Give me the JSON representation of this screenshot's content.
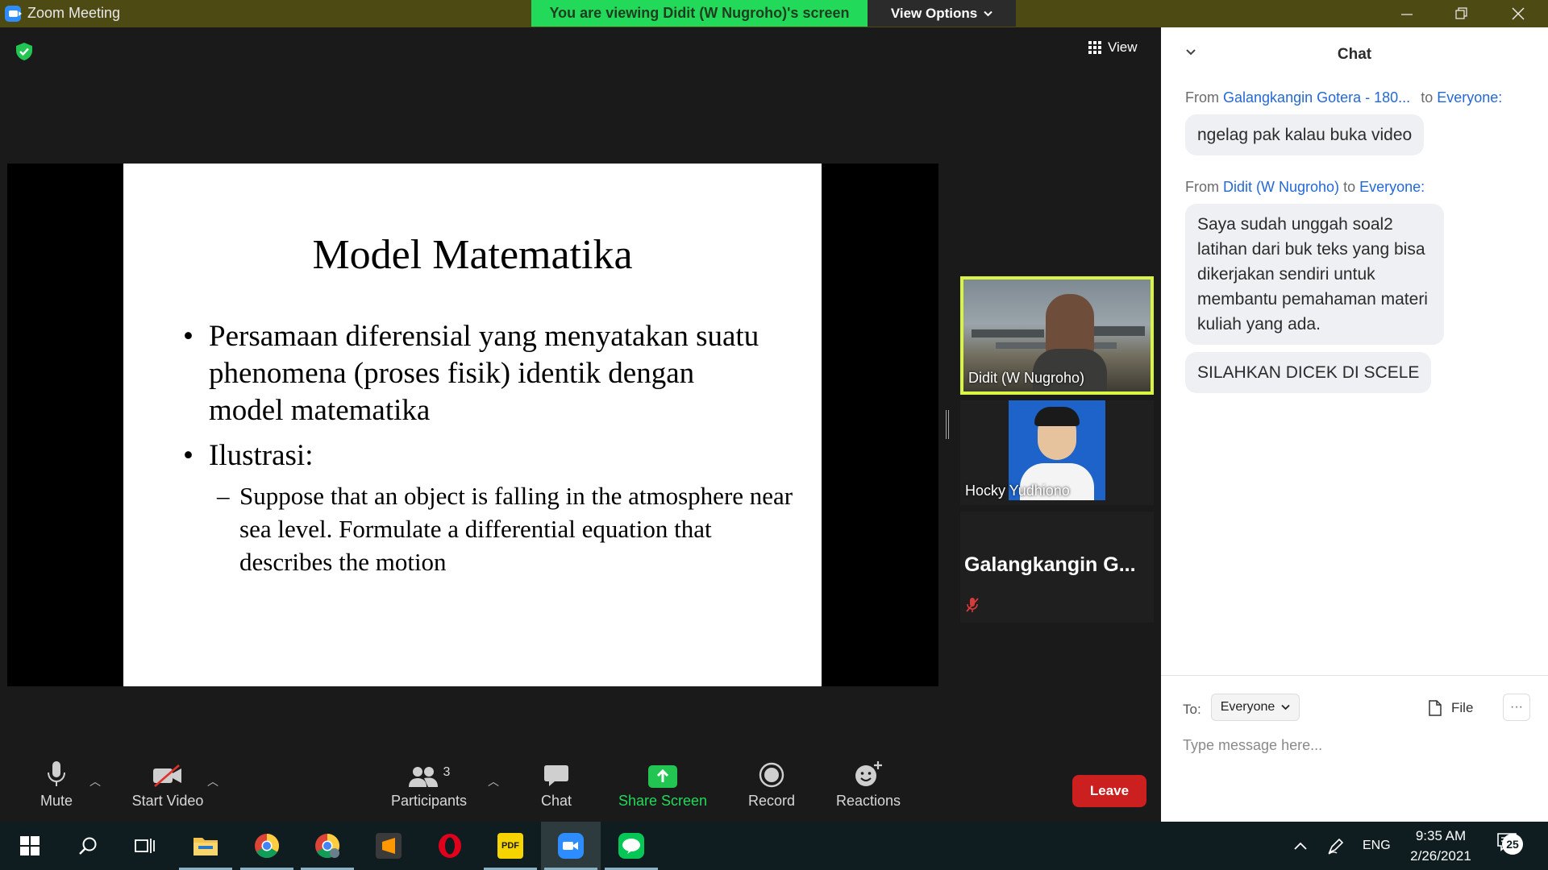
{
  "window": {
    "app_title": "Zoom Meeting",
    "viewing_banner": "You are viewing Didit (W Nugroho)'s screen",
    "view_options_label": "View Options"
  },
  "stage": {
    "view_button_label": "View"
  },
  "slide": {
    "title": "Model Matematika",
    "bullet1": "Persamaan diferensial yang menyatakan suatu phenomena (proses fisik) identik dengan model matematika",
    "bullet2": "Ilustrasi:",
    "sub_bullet": "Suppose that an object is falling in the atmosphere near sea level. Formulate a differential equation that describes the motion",
    "bullet_glyph": "•",
    "dash_glyph": "–"
  },
  "participants_tiles": [
    {
      "name": "Didit (W Nugroho)"
    },
    {
      "name": "Hocky Yudhiono"
    },
    {
      "name": "Galangkangin  G..."
    }
  ],
  "toolbar": {
    "mute": "Mute",
    "start_video": "Start Video",
    "participants": "Participants",
    "participants_count": "3",
    "chat": "Chat",
    "share_screen": "Share Screen",
    "record": "Record",
    "reactions": "Reactions",
    "leave": "Leave"
  },
  "chat": {
    "title": "Chat",
    "messages": [
      {
        "from_prefix": "From",
        "sender": "Galangkangin Gotera - 180...",
        "to_prefix": "to",
        "recipient": "Everyone:",
        "text": "ngelag pak kalau buka video"
      },
      {
        "from_prefix": "From",
        "sender": "Didit (W Nugroho)",
        "to_prefix": "to",
        "recipient": "Everyone:",
        "text": "Saya sudah unggah soal2 latihan dari buk teks yang bisa dikerjakan sendiri untuk membantu pemahaman materi kuliah yang ada.",
        "text2": "SILAHKAN DICEK DI SCELE"
      }
    ],
    "to_label": "To:",
    "to_value": "Everyone",
    "file_label": "File",
    "more_label": "···",
    "input_placeholder": "Type message here..."
  },
  "taskbar": {
    "language": "ENG",
    "time": "9:35 AM",
    "date": "2/26/2021",
    "notification_count": "25",
    "apps": [
      "windows-start",
      "search",
      "task-view",
      "file-explorer",
      "chrome",
      "chrome-profile",
      "sublime-text",
      "opera",
      "pdf-reader",
      "zoom",
      "line"
    ]
  },
  "colors": {
    "title_bar": "#4e4a14",
    "viewing_banner": "#23d959",
    "active_speaker_border": "#d9f542",
    "leave_button": "#cc1f1f",
    "chat_link": "#2468d6",
    "taskbar": "#0f1d21"
  }
}
